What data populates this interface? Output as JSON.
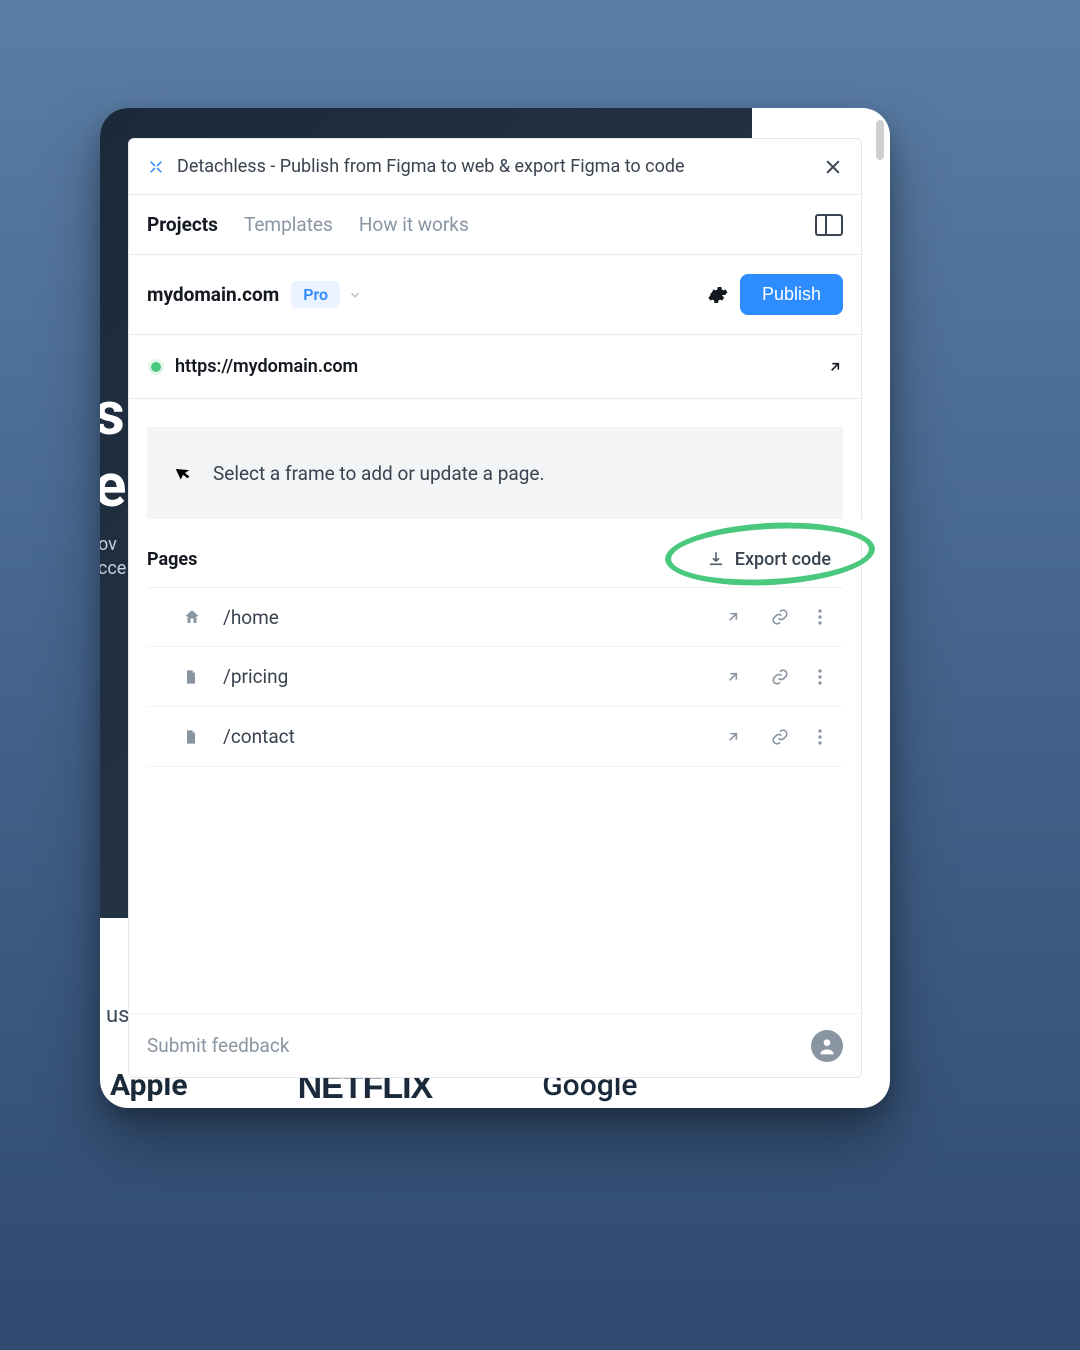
{
  "background": {
    "heading_frag_1": "s",
    "heading_frag_2": "es",
    "sub_frag_1": "nov",
    "sub_frag_2": "ucce",
    "trusted_frag": "uste",
    "logos": [
      "Apple",
      "NETFLIX",
      "Google"
    ]
  },
  "panel": {
    "title": "Detachless - Publish from Figma to web & export Figma to code",
    "tabs": [
      {
        "label": "Projects",
        "active": true
      },
      {
        "label": "Templates",
        "active": false
      },
      {
        "label": "How it works",
        "active": false
      }
    ],
    "domain": {
      "name": "mydomain.com",
      "badge": "Pro",
      "publish_label": "Publish"
    },
    "live_url": "https://mydomain.com",
    "hint": "Select a frame to add or update a page.",
    "pages_title": "Pages",
    "export_label": "Export code",
    "pages": [
      {
        "icon": "home",
        "path": "/home"
      },
      {
        "icon": "file",
        "path": "/pricing"
      },
      {
        "icon": "file",
        "path": "/contact"
      }
    ],
    "feedback_label": "Submit feedback"
  }
}
